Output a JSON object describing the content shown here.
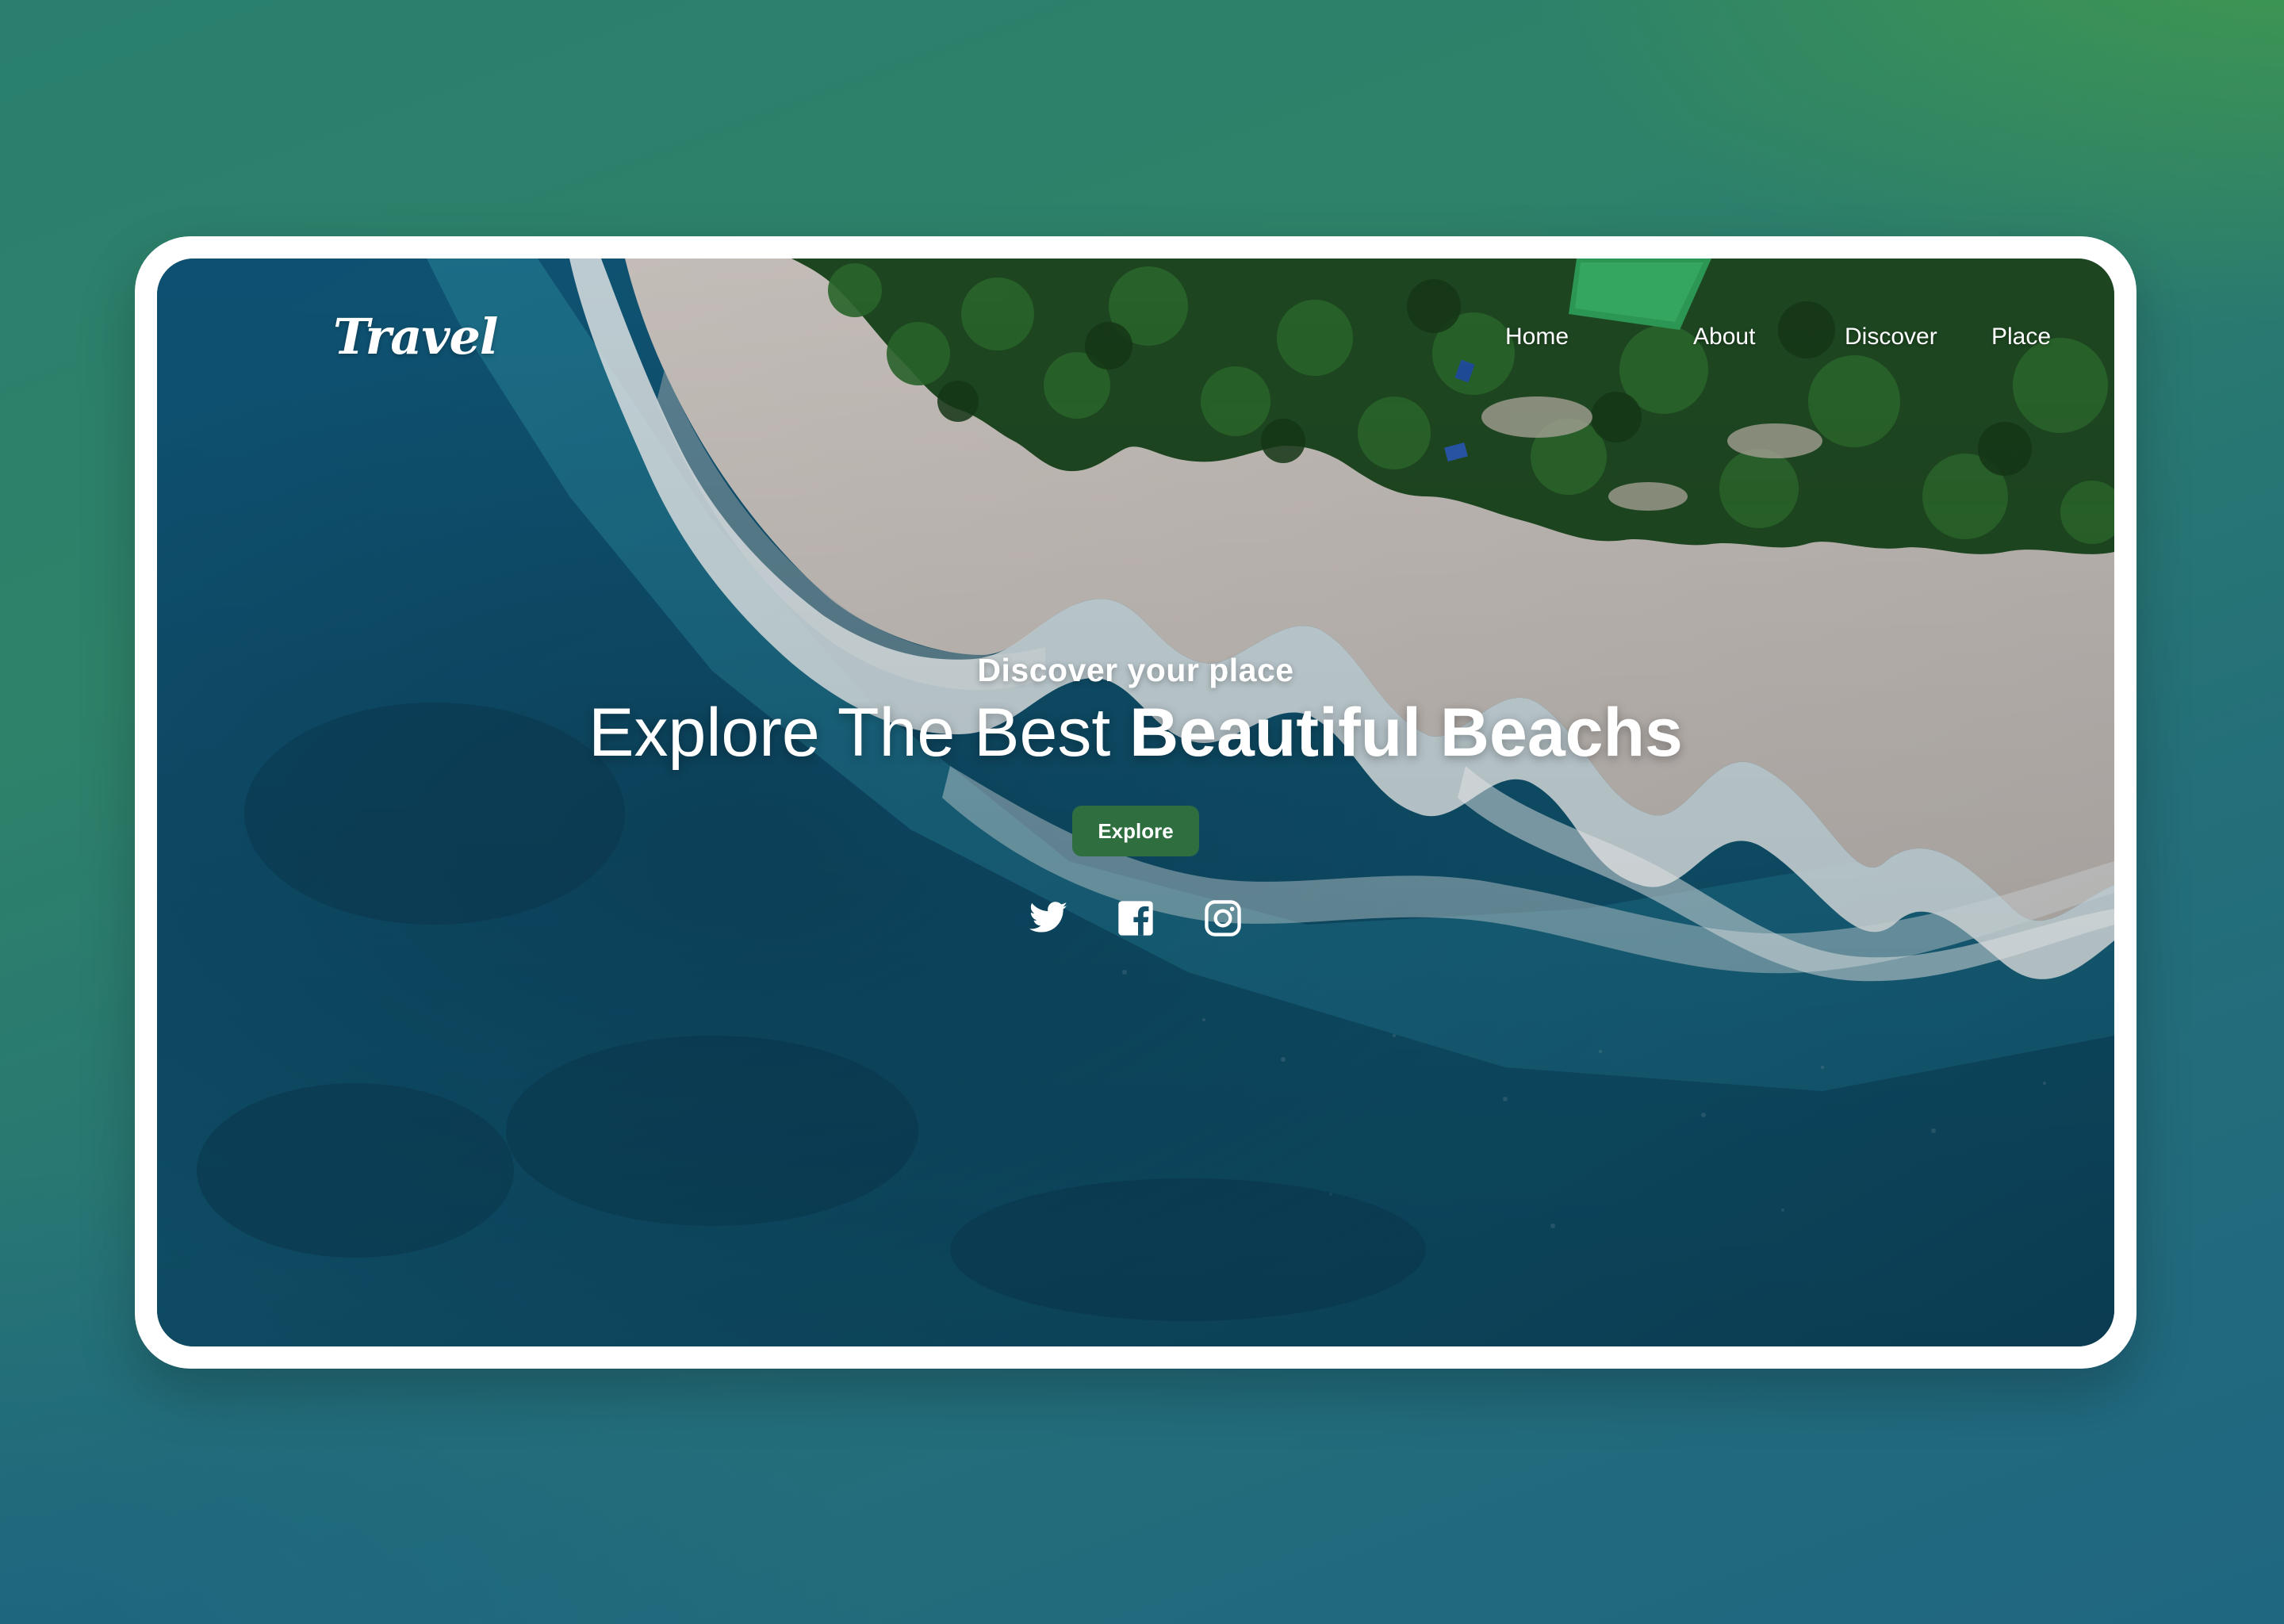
{
  "brand": {
    "logo": "Travel"
  },
  "nav": {
    "items": [
      {
        "label": "Home"
      },
      {
        "label": "About"
      },
      {
        "label": "Discover"
      },
      {
        "label": "Place"
      }
    ]
  },
  "hero": {
    "subtitle": "Discover your place",
    "title_regular": "Explore The Best ",
    "title_bold": "Beautiful Beachs",
    "button_label": "Explore"
  },
  "social": [
    {
      "icon": "twitter-icon"
    },
    {
      "icon": "facebook-icon"
    },
    {
      "icon": "instagram-icon"
    }
  ],
  "colors": {
    "accent_button": "#2f6e3f",
    "ocean": "#13506a",
    "sand": "#c8c4c0",
    "foliage": "#1f4a22",
    "background_green": "#45a045",
    "background_teal": "#1f6680"
  }
}
